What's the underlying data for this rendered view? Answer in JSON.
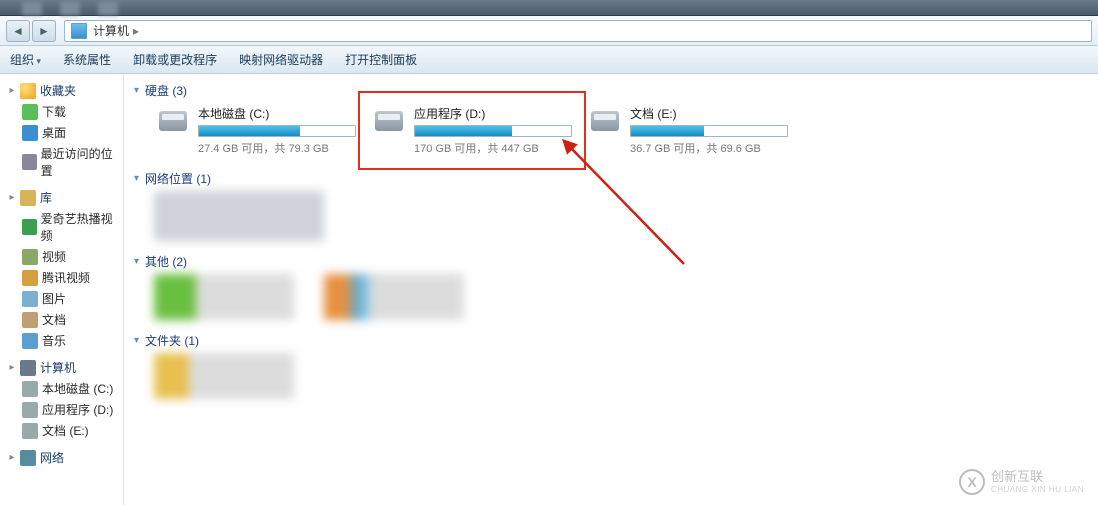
{
  "address": {
    "root": "计算机"
  },
  "toolbar": {
    "organize": "组织",
    "sysprops": "系统属性",
    "uninstall": "卸载或更改程序",
    "mapdrive": "映射网络驱动器",
    "cpanel": "打开控制面板"
  },
  "sidebar": {
    "favorites": {
      "label": "收藏夹",
      "items": [
        {
          "icon": "ic-dl",
          "label": "下载"
        },
        {
          "icon": "ic-desk",
          "label": "桌面"
        },
        {
          "icon": "ic-recent",
          "label": "最近访问的位置"
        }
      ]
    },
    "libraries": {
      "label": "库",
      "items": [
        {
          "icon": "ic-iqy",
          "label": "爱奇艺热播视频"
        },
        {
          "icon": "ic-vid",
          "label": "视频"
        },
        {
          "icon": "ic-vid3",
          "label": "腾讯视频"
        },
        {
          "icon": "ic-pic",
          "label": "图片"
        },
        {
          "icon": "ic-doc2",
          "label": "文档"
        },
        {
          "icon": "ic-music",
          "label": "音乐"
        }
      ]
    },
    "computer": {
      "label": "计算机",
      "items": [
        {
          "icon": "ic-dc",
          "label": "本地磁盘 (C:)"
        },
        {
          "icon": "ic-dd",
          "label": "应用程序 (D:)"
        },
        {
          "icon": "ic-de",
          "label": "文档 (E:)"
        }
      ]
    },
    "network": {
      "label": "网络"
    }
  },
  "groups": {
    "drives": {
      "label": "硬盘 (3)",
      "items": [
        {
          "name": "本地磁盘 (C:)",
          "sub": "27.4 GB 可用，共 79.3 GB",
          "fill": 65
        },
        {
          "name": "应用程序 (D:)",
          "sub": "170 GB 可用，共 447 GB",
          "fill": 62,
          "highlight": true
        },
        {
          "name": "文档 (E:)",
          "sub": "36.7 GB 可用，共 69.6 GB",
          "fill": 47
        }
      ]
    },
    "netloc": {
      "label": "网络位置 (1)"
    },
    "other": {
      "label": "其他 (2)"
    },
    "folders": {
      "label": "文件夹 (1)"
    }
  },
  "watermark": {
    "brand": "创新互联",
    "sub": "CHUANG XIN HU LIAN",
    "mark": "X"
  }
}
